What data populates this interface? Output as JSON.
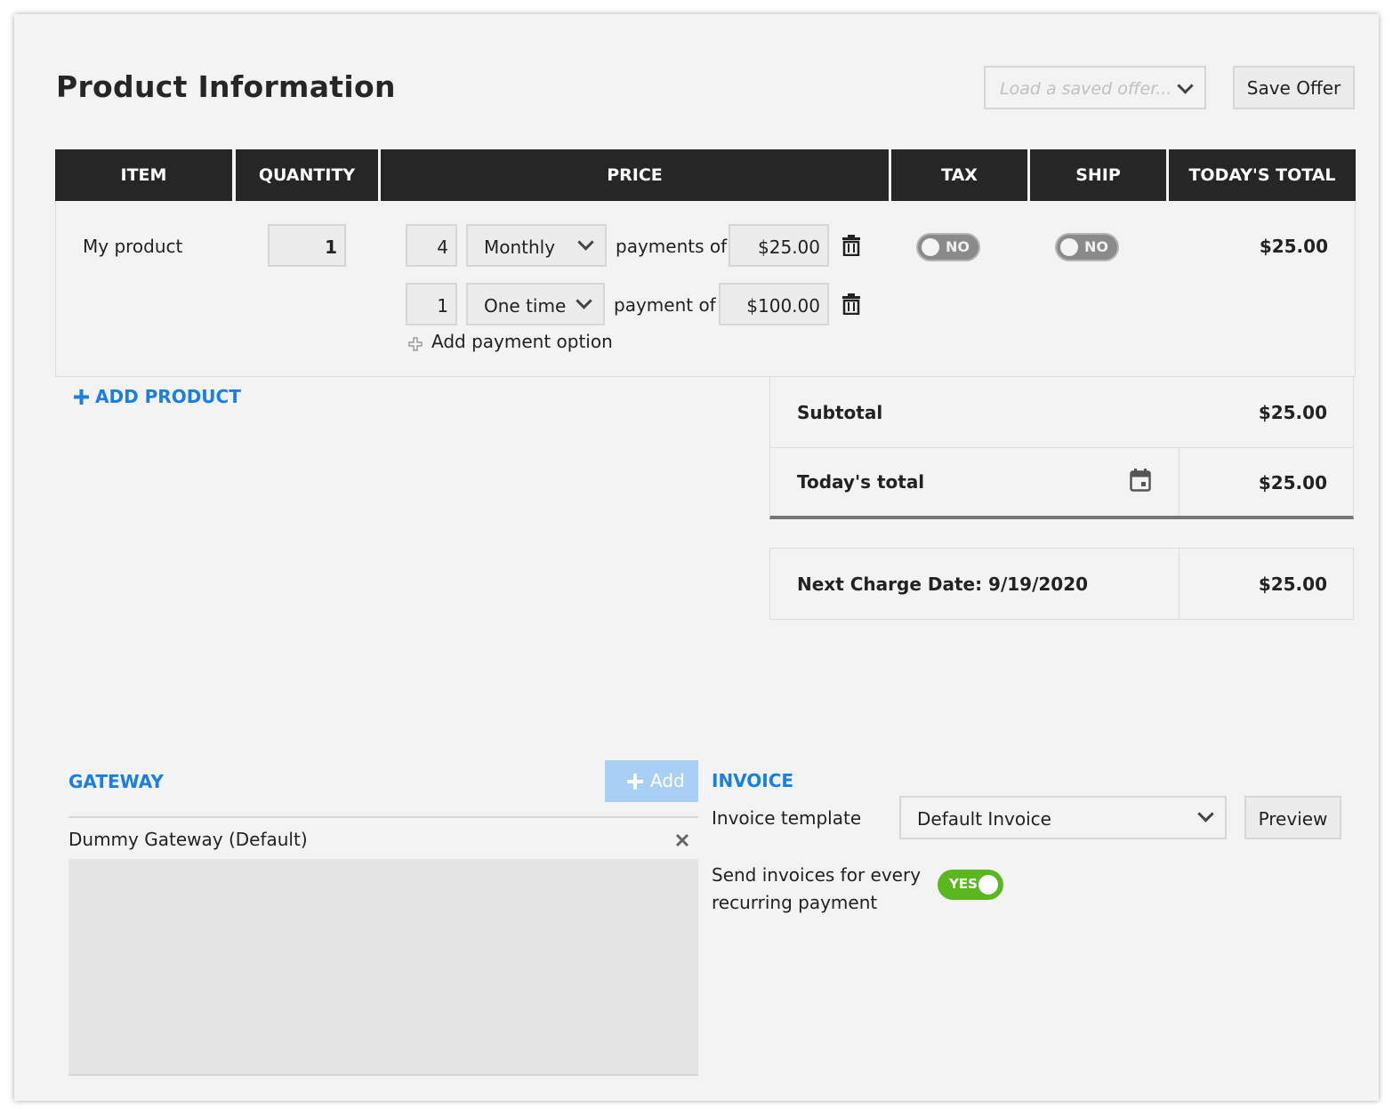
{
  "page_title": "Product Information",
  "offer_select": {
    "placeholder": "Load a saved offer..."
  },
  "save_offer_label": "Save Offer",
  "table": {
    "headers": [
      "ITEM",
      "QUANTITY",
      "PRICE",
      "TAX",
      "SHIP",
      "TODAY'S TOTAL"
    ],
    "product": {
      "name": "My product",
      "quantity": "1",
      "payments": [
        {
          "count": "4",
          "frequency": "Monthly",
          "connector": "payments of",
          "amount": "$25.00"
        },
        {
          "count": "1",
          "frequency": "One time",
          "connector": "payment of",
          "amount": "$100.00"
        }
      ],
      "add_payment_label": "Add payment option",
      "tax_toggle": "NO",
      "ship_toggle": "NO",
      "total": "$25.00"
    }
  },
  "add_product_label": "ADD PRODUCT",
  "summary": {
    "subtotal_label": "Subtotal",
    "subtotal_value": "$25.00",
    "todays_total_label": "Today's total",
    "todays_total_value": "$25.00",
    "next_charge_label": "Next Charge Date: 9/19/2020",
    "next_charge_value": "$25.00"
  },
  "gateway": {
    "heading": "GATEWAY",
    "add_label": "Add",
    "item": "Dummy Gateway (Default)"
  },
  "invoice": {
    "heading": "INVOICE",
    "template_label": "Invoice template",
    "template_value": "Default Invoice",
    "preview_label": "Preview",
    "send_label_line1": "Send invoices for every",
    "send_label_line2": "recurring payment",
    "send_toggle": "YES"
  },
  "colors": {
    "header_bg": "#262626",
    "accent_blue": "#1a7fe0",
    "toggle_on": "#5bb71f",
    "toggle_off": "#8a8a8a",
    "add_button_disabled": "#a9cff5"
  }
}
